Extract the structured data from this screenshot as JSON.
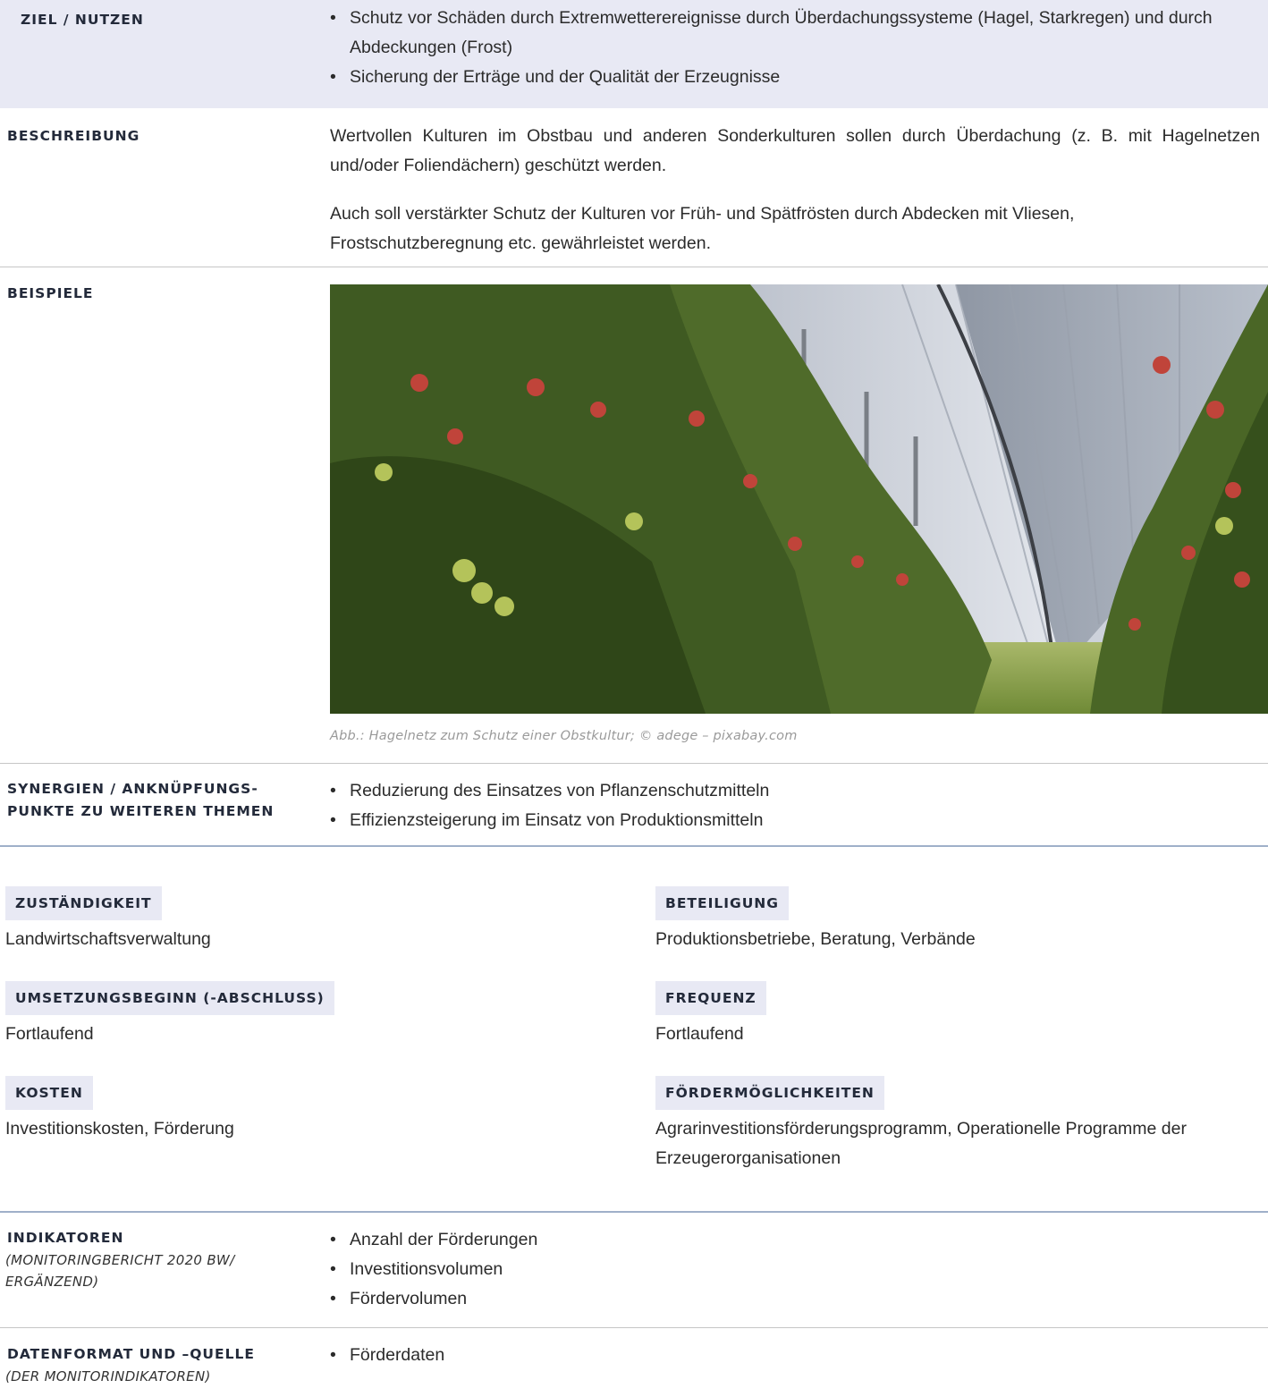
{
  "ziel": {
    "label": "ZIEL / NUTZEN",
    "bullets": [
      "Schutz vor Schäden durch Extremwetterereignisse durch Überdachungssysteme (Hagel, Starkregen) und durch Abdeckungen (Frost)",
      "Sicherung der Erträge und der Qualität der Erzeugnisse"
    ]
  },
  "beschreibung": {
    "label": "BESCHREIBUNG",
    "paragraphs": [
      "Wertvollen Kulturen im Obstbau und anderen Sonderkulturen sollen durch Überdachung (z. B. mit Hagelnetzen und/oder Foliendächern) geschützt werden.",
      "Auch soll verstärkter Schutz der Kulturen vor Früh- und Spätfrösten durch Abdecken mit Vliesen, Frostschutzberegnung etc. gewährleistet werden."
    ]
  },
  "beispiele": {
    "label": "BEISPIELE",
    "caption": "Abb.: Hagelnetz zum Schutz einer Obstkultur; © adege – pixabay.com"
  },
  "synergien": {
    "label_line1": "SYNERGIEN / ANKNÜPFUNGS-",
    "label_line2": "PUNKTE ZU WEITEREN THEMEN",
    "bullets": [
      "Reduzierung des Einsatzes von Pflanzenschutzmitteln",
      "Effizienzsteigerung im Einsatz von Produktionsmitteln"
    ]
  },
  "fields": {
    "zustaendigkeit": {
      "label": "ZUSTÄNDIGKEIT",
      "value": "Landwirtschaftsverwaltung"
    },
    "beteiligung": {
      "label": "BETEILIGUNG",
      "value": "Produktionsbetriebe, Beratung, Verbände"
    },
    "umsetzung": {
      "label": "UMSETZUNGSBEGINN (-ABSCHLUSS)",
      "value": "Fortlaufend"
    },
    "frequenz": {
      "label": "FREQUENZ",
      "value": "Fortlaufend"
    },
    "kosten": {
      "label": "KOSTEN",
      "value": "Investitionskosten, Förderung"
    },
    "foerder": {
      "label": "FÖRDERMÖGLICHKEITEN",
      "value_line1": "Agrarinvestitionsförderungsprogramm, Operationelle Programme der",
      "value_line2": "Erzeugerorganisationen"
    }
  },
  "indikatoren": {
    "label": "INDIKATOREN",
    "sub_line1": "(MONITORINGBERICHT 2020 BW/",
    "sub_line2": "ERGÄNZEND)",
    "bullets": [
      "Anzahl der Förderungen",
      "Investitionsvolumen",
      "Fördervolumen"
    ]
  },
  "datenformat": {
    "label": "DATENFORMAT UND –QUELLE",
    "sub": "(DER MONITORINDIKATOREN)",
    "bullets": [
      "Förderdaten"
    ]
  }
}
